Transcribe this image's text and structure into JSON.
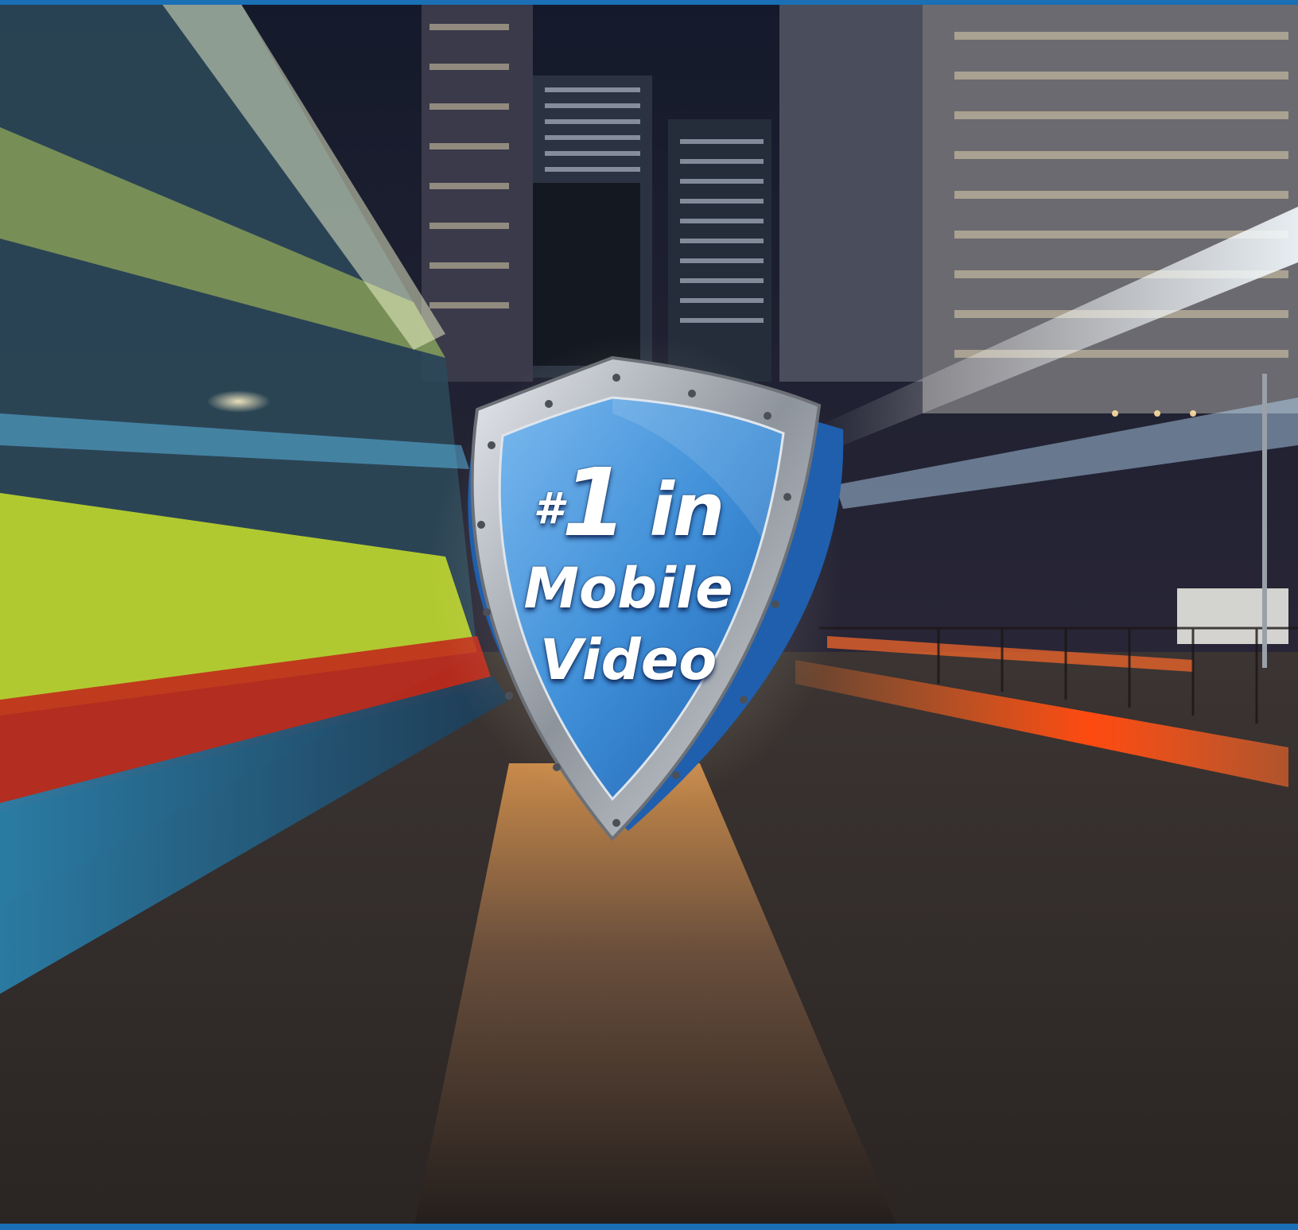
{
  "badge": {
    "hash": "#",
    "number": "1",
    "line1_suffix": "in",
    "line2": "Mobile",
    "line3": "Video"
  },
  "colors": {
    "frame": "#1a6fb5",
    "shield_blue": "#3f8fd8",
    "shield_metal": "#b9bec5",
    "sky": "#1a1f33",
    "light_trail_warm": "#ff5a1f",
    "light_trail_cool": "#e9f6ff",
    "bus_yellow": "#c9e02a",
    "bus_teal": "#1f8db0"
  },
  "icons": [
    "shield-icon",
    "rivet-icon"
  ]
}
